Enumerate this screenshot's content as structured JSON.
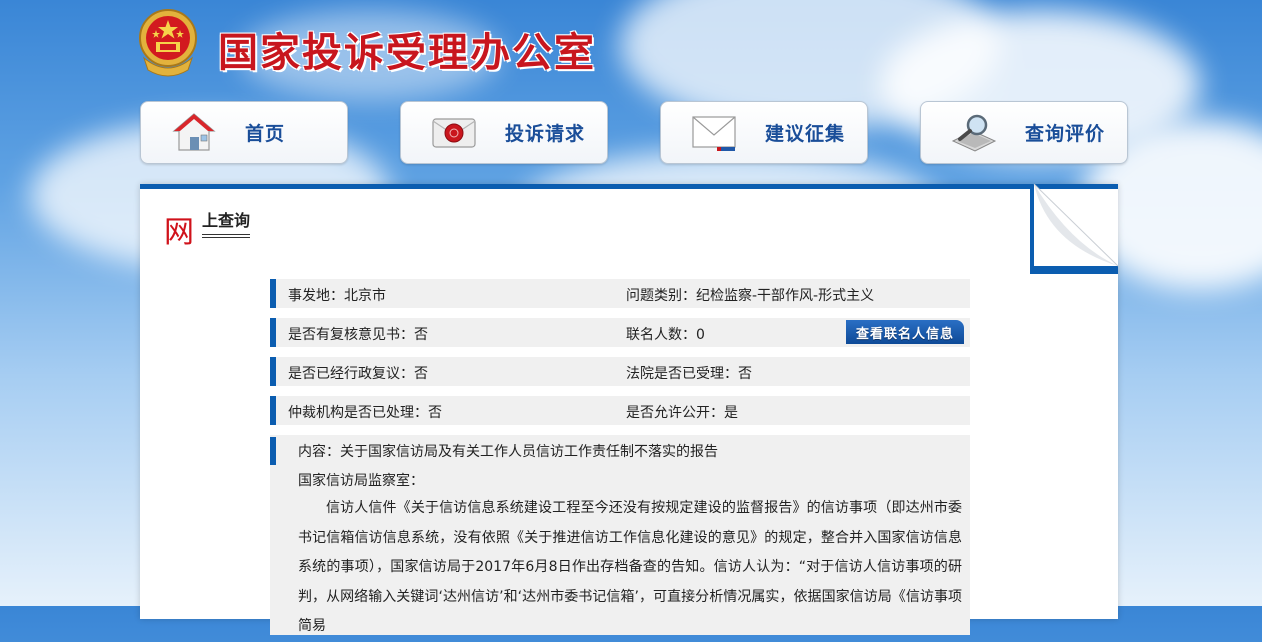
{
  "header": {
    "site_title": "国家投诉受理办公室",
    "emblem_icon": "national-emblem-icon"
  },
  "nav": [
    {
      "label": "首页",
      "icon": "home-icon"
    },
    {
      "label": "投诉请求",
      "icon": "seal-letter-icon"
    },
    {
      "label": "建议征集",
      "icon": "envelope-icon"
    },
    {
      "label": "查询评价",
      "icon": "magnifier-keyboard-icon"
    }
  ],
  "section": {
    "title_big": "网",
    "title_rest": "上查询"
  },
  "info": {
    "location_label": "事发地：",
    "location_value": "北京市",
    "category_label": "问题类别：",
    "category_value": "纪检监察-干部作风-形式主义",
    "review_label": "是否有复核意见书：",
    "review_value": "否",
    "signers_label": "联名人数：",
    "signers_value": "0",
    "signers_button": "查看联名人信息",
    "admin_review_label": "是否已经行政复议：",
    "admin_review_value": "否",
    "court_label": "法院是否已受理：",
    "court_value": "否",
    "arbitration_label": "仲裁机构是否已处理：",
    "arbitration_value": "否",
    "public_label": "是否允许公开：",
    "public_value": "是"
  },
  "content": {
    "line1": "内容：关于国家信访局及有关工作人员信访工作责任制不落实的报告",
    "line2": "国家信访局监察室：",
    "paragraph": "信访人信件《关于信访信息系统建设工程至今还没有按规定建设的监督报告》的信访事项（即达州市委书记信箱信访信息系统，没有依照《关于推进信访工作信息化建设的意见》的规定，整合并入国家信访信息系统的事项），国家信访局于2017年6月8日作出存档备查的告知。信访人认为：“对于信访人信访事项的研判，从网络输入关键词‘达州信访’和‘达州市委书记信箱’，可直接分析情况属实，依据国家信访局《信访事项简易"
  },
  "colors": {
    "title_red": "#c8161e",
    "nav_blue": "#1a4e99",
    "accent_blue": "#0b5db0",
    "row_gray": "#f0f0f0"
  }
}
